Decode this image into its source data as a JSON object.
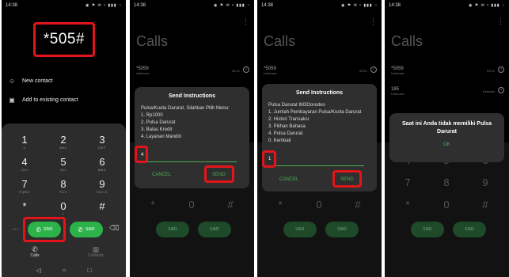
{
  "status": {
    "time": "14:38",
    "icons": "◉ ⚑ ✉ • ▮▮▮ ◔"
  },
  "panel1": {
    "ussd_code": "*505#",
    "menu": [
      {
        "icon": "person-add-icon",
        "label": "New contact"
      },
      {
        "icon": "contact-card-icon",
        "label": "Add to existing contact"
      }
    ],
    "keys": [
      {
        "digit": "1",
        "letters": ""
      },
      {
        "digit": "2",
        "letters": "ABC"
      },
      {
        "digit": "3",
        "letters": "DEF"
      },
      {
        "digit": "4",
        "letters": "GHI"
      },
      {
        "digit": "5",
        "letters": "JKL"
      },
      {
        "digit": "6",
        "letters": "MNO"
      },
      {
        "digit": "7",
        "letters": "PQRS"
      },
      {
        "digit": "8",
        "letters": "TUV"
      },
      {
        "digit": "9",
        "letters": "WXYZ"
      },
      {
        "digit": "*",
        "letters": ""
      },
      {
        "digit": "0",
        "letters": "+"
      },
      {
        "digit": "#",
        "letters": ""
      }
    ],
    "sim1_label": "SIM1",
    "sim2_label": "SIM2",
    "tabs": [
      {
        "label": "Calls"
      },
      {
        "label": "Contacts"
      }
    ]
  },
  "calls_screen": {
    "title": "Calls",
    "items": [
      {
        "number": "*5059",
        "sub": "Unknown",
        "meta": "09:21"
      },
      {
        "number": "185",
        "sub": "Unknown",
        "meta": "Kemarin"
      },
      {
        "number": "",
        "sub": "",
        "meta": ""
      }
    ]
  },
  "dialog2": {
    "title": "Send Instructions",
    "lines": [
      "Pulsa/Kuota Darurat, Silahkan Pilih Menu:",
      "1. Rp1000",
      "2. Pulsa Darurat",
      "3. Batas Kredit",
      "4. Layanan Mandiri"
    ],
    "input_value": "4",
    "cancel": "CANCEL",
    "send": "SEND"
  },
  "dialog3": {
    "title": "Send Instructions",
    "lines": [
      "Pulsa Darurat IM3Ooredoo",
      "1. Jumlah Pembayaran Pulsa/Kuota Darurat",
      "2. Histori Transaksi",
      "3. Pilihan Bahasa",
      "4. Pulsa Darurat",
      "0. Kembali"
    ],
    "input_value": "1",
    "cancel": "CANCEL",
    "send": "SEND"
  },
  "alert4": {
    "message": "Saat ini Anda tidak memiliki Pulsa Darurat",
    "ok": "OK"
  },
  "colors": {
    "highlight": "#e3151a",
    "call_green": "#2db24a",
    "accent": "#4caf50"
  }
}
